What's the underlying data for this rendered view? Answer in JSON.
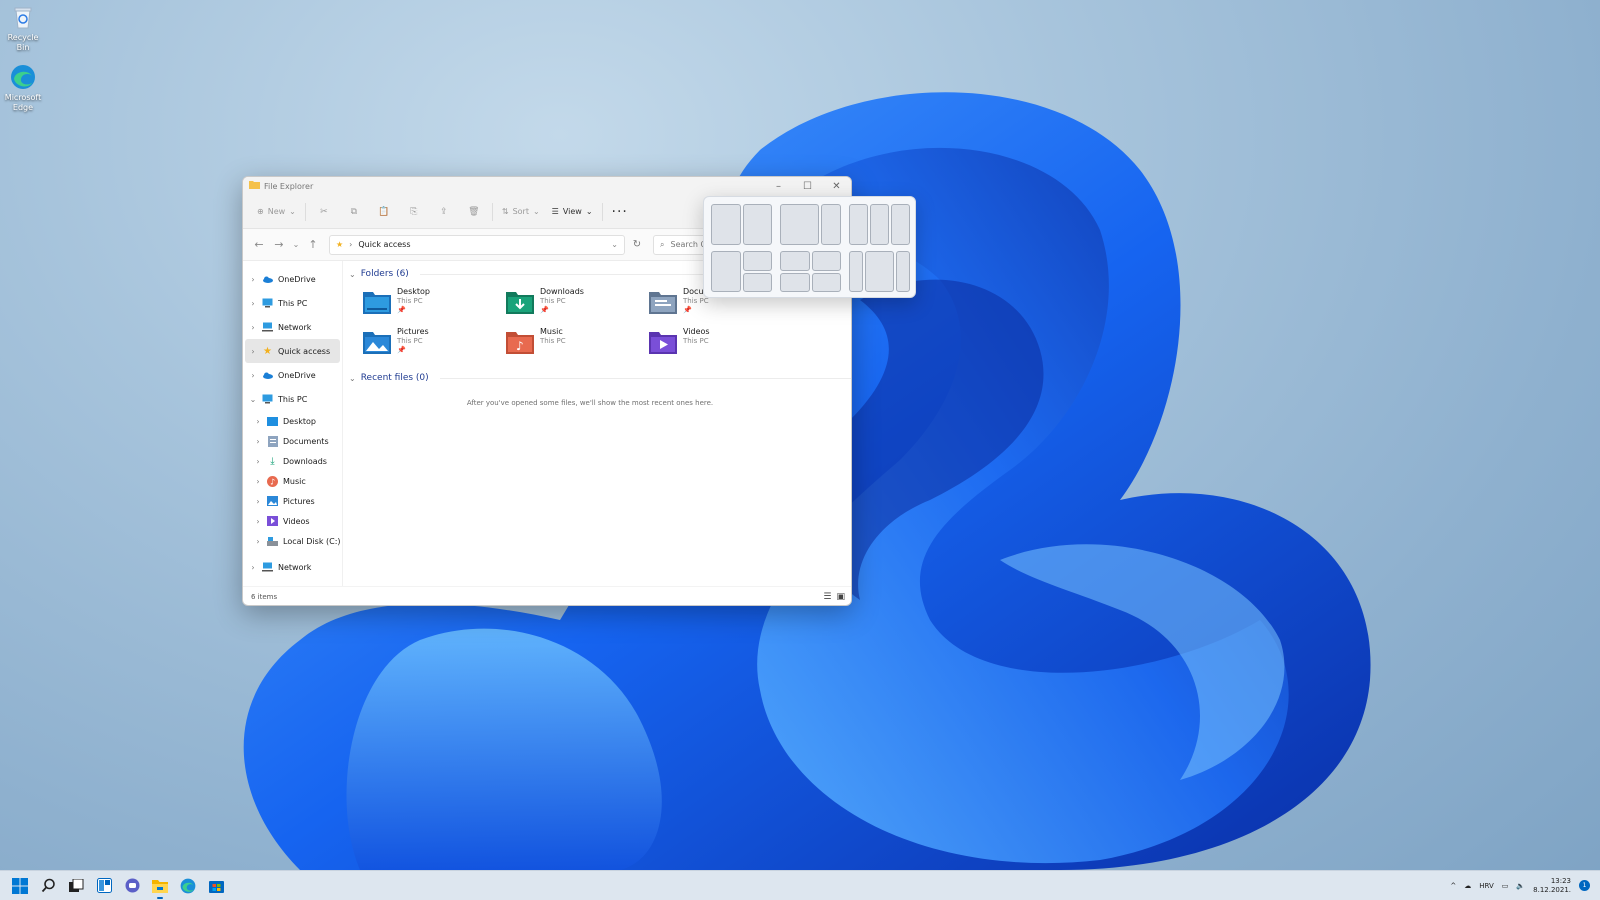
{
  "desktop": {
    "icons": [
      {
        "label": "Recycle Bin",
        "icon": "recycle-bin-icon"
      },
      {
        "label": "Microsoft Edge",
        "icon": "edge-icon"
      }
    ]
  },
  "window": {
    "title": "File Explorer",
    "toolbar": {
      "new_label": "New",
      "sort_label": "Sort",
      "view_label": "View",
      "more_label": "···"
    },
    "address": {
      "location": "Quick access",
      "search_placeholder": "Search Quick access"
    },
    "sidebar": {
      "items": [
        {
          "label": "OneDrive",
          "icon": "onedrive-icon"
        },
        {
          "label": "This PC",
          "icon": "pc-icon"
        },
        {
          "label": "Network",
          "icon": "network-icon"
        },
        {
          "label": "Quick access",
          "icon": "star-icon",
          "active": true
        },
        {
          "label": "OneDrive",
          "icon": "onedrive-icon"
        },
        {
          "label": "This PC",
          "icon": "pc-icon",
          "expanded": true
        },
        {
          "label": "Desktop",
          "icon": "desktop-icon"
        },
        {
          "label": "Documents",
          "icon": "documents-icon"
        },
        {
          "label": "Downloads",
          "icon": "downloads-icon"
        },
        {
          "label": "Music",
          "icon": "music-icon"
        },
        {
          "label": "Pictures",
          "icon": "pictures-icon"
        },
        {
          "label": "Videos",
          "icon": "videos-icon"
        },
        {
          "label": "Local Disk (C:)",
          "icon": "disk-icon"
        },
        {
          "label": "Network",
          "icon": "network-icon"
        }
      ]
    },
    "folders_header": "Folders (6)",
    "folders": [
      {
        "name": "Desktop",
        "location": "This PC",
        "color": "#1f8fe0"
      },
      {
        "name": "Downloads",
        "location": "This PC",
        "color": "#1aa37a"
      },
      {
        "name": "Documents",
        "location": "This PC",
        "color": "#7f95b0"
      },
      {
        "name": "Pictures",
        "location": "This PC",
        "color": "#2b88d8"
      },
      {
        "name": "Music",
        "location": "This PC",
        "color": "#e86a4f"
      },
      {
        "name": "Videos",
        "location": "This PC",
        "color": "#7a4fd8"
      }
    ],
    "recent_header": "Recent files (0)",
    "recent_empty": "After you've opened some files, we'll show the most recent ones here.",
    "status": "6 items"
  },
  "taskbar": {
    "apps": [
      "start-icon",
      "search-icon",
      "task-view-icon",
      "widgets-icon",
      "chat-icon",
      "file-explorer-icon",
      "edge-icon",
      "store-icon"
    ],
    "tray": {
      "language": "HRV",
      "time": "13:23",
      "date": "8.12.2021.",
      "notifications": "1"
    }
  },
  "colors": {
    "accent": "#0067c0",
    "link_header": "#1f3b91"
  }
}
